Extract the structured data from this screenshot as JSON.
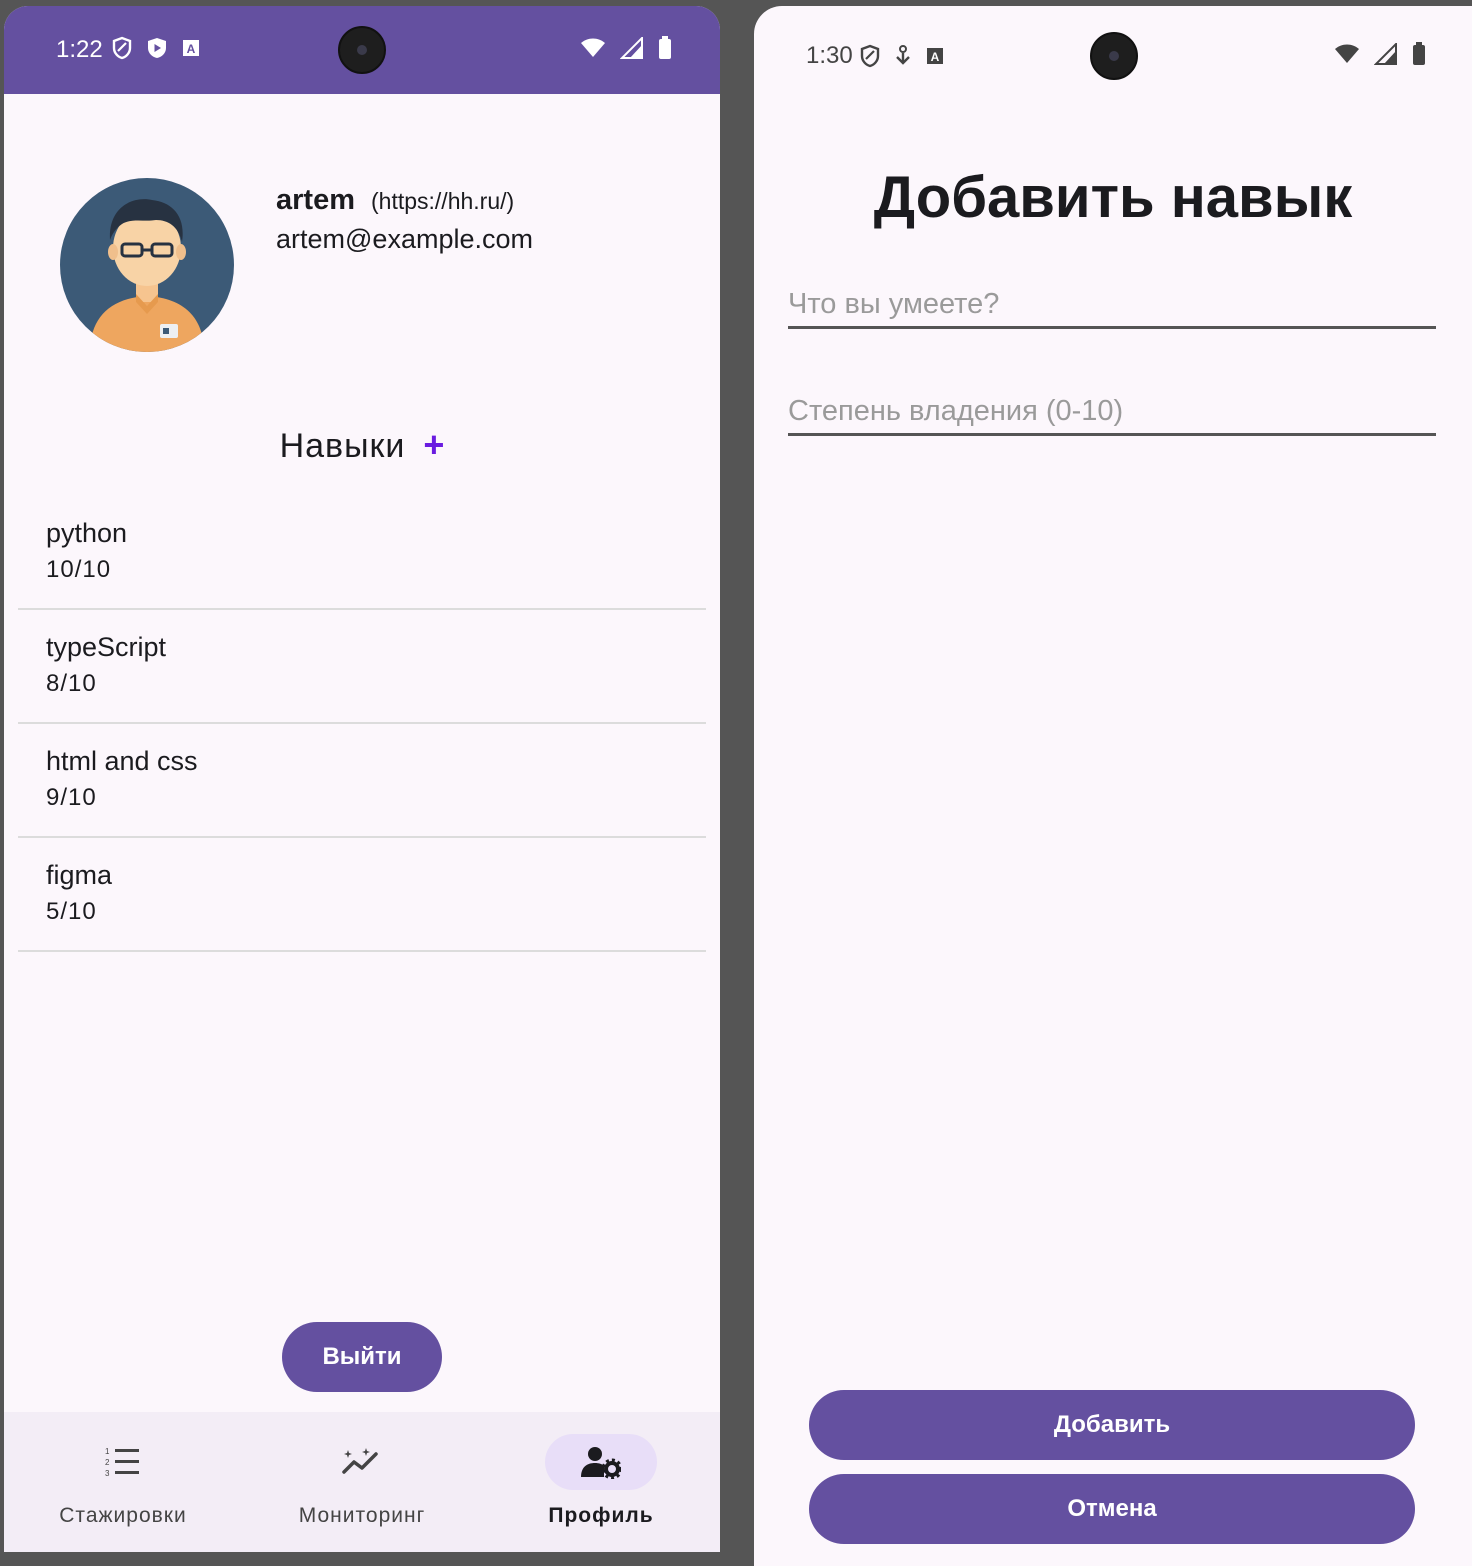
{
  "left_screen": {
    "status": {
      "time": "1:22"
    },
    "profile": {
      "name": "artem",
      "link": "(https://hh.ru/)",
      "email": "artem@example.com"
    },
    "skills": {
      "title": "Навыки",
      "add_symbol": "+",
      "items": [
        {
          "name": "python",
          "level": "10/10"
        },
        {
          "name": "typeScript",
          "level": "8/10"
        },
        {
          "name": "html and css",
          "level": "9/10"
        },
        {
          "name": "figma",
          "level": "5/10"
        }
      ]
    },
    "logout_label": "Выйти",
    "bottom_nav": [
      {
        "label": "Стажировки",
        "icon": "numbered-list-icon",
        "active": false
      },
      {
        "label": "Мониторинг",
        "icon": "trending-sparkle-icon",
        "active": false
      },
      {
        "label": "Профиль",
        "icon": "person-settings-icon",
        "active": true
      }
    ]
  },
  "right_screen": {
    "status": {
      "time": "1:30"
    },
    "title": "Добавить навык",
    "skill_placeholder": "Что вы умеете?",
    "level_placeholder": "Степень владения (0-10)",
    "add_label": "Добавить",
    "cancel_label": "Отмена"
  },
  "colors": {
    "primary": "#6450A0",
    "accent_plus": "#6A1CE0",
    "background": "#FCF7FC",
    "nav_background": "#F3EDF6",
    "nav_active_pill": "#E8DEF8"
  }
}
